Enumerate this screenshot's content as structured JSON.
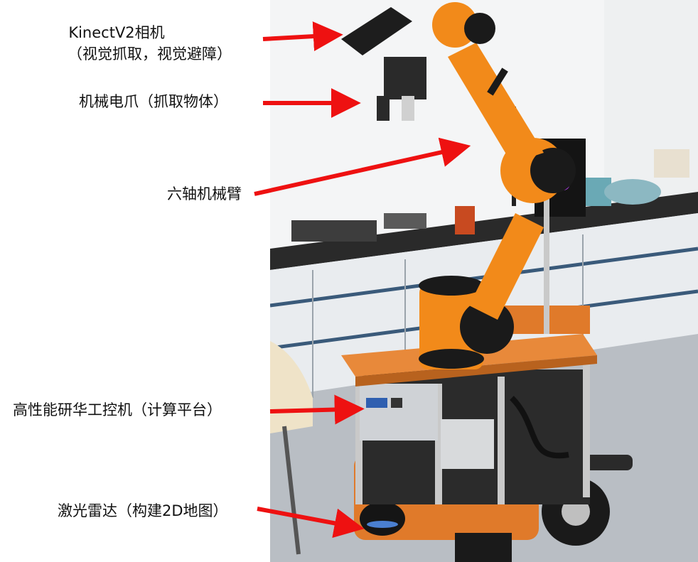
{
  "labels": {
    "camera_line1": "KinectV2相机",
    "camera_line2": "（视觉抓取，视觉避障）",
    "gripper": "机械电爪（抓取物体）",
    "arm": "六轴机械臂",
    "computer": "高性能研华工控机（计算平台）",
    "lidar": "激光雷达（构建2D地图）"
  },
  "colors": {
    "arrow": "#ee1111",
    "arm_orange": "#f28a1a",
    "base_orange": "#e07a2a",
    "joint_black": "#1a1a1a",
    "floor": "#b9bec4",
    "cabinet": "#e9ecef",
    "bench": "#2a2a2a"
  }
}
